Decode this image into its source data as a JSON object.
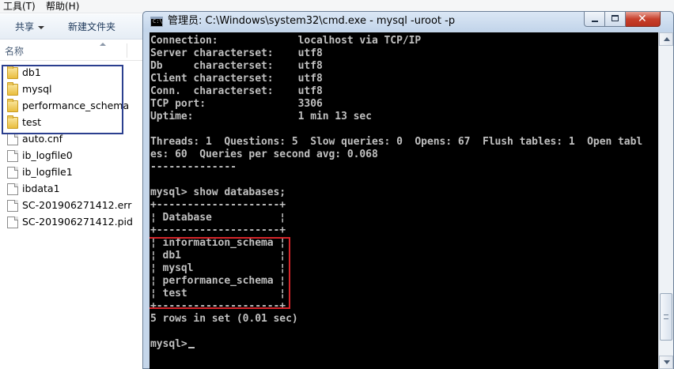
{
  "explorer": {
    "menu": [
      "工具(T)",
      "帮助(H)"
    ],
    "toolbar": {
      "share_label": "共享",
      "new_folder_label": "新建文件夹"
    },
    "column_header": "名称",
    "files": [
      {
        "name": "db1",
        "type": "folder"
      },
      {
        "name": "mysql",
        "type": "folder"
      },
      {
        "name": "performance_schema",
        "type": "folder"
      },
      {
        "name": "test",
        "type": "folder"
      },
      {
        "name": "auto.cnf",
        "type": "file"
      },
      {
        "name": "ib_logfile0",
        "type": "file"
      },
      {
        "name": "ib_logfile1",
        "type": "file"
      },
      {
        "name": "ibdata1",
        "type": "file"
      },
      {
        "name": "SC-201906271412.err",
        "type": "file"
      },
      {
        "name": "SC-201906271412.pid",
        "type": "file"
      }
    ],
    "highlight_color": "#2b3f8f"
  },
  "cmd": {
    "icon_text": "C:\\",
    "title": "管理员: C:\\Windows\\system32\\cmd.exe - mysql  -uroot -p",
    "close_glyph": "✕",
    "lines": [
      "Connection:             localhost via TCP/IP",
      "Server characterset:    utf8",
      "Db     characterset:    utf8",
      "Client characterset:    utf8",
      "Conn.  characterset:    utf8",
      "TCP port:               3306",
      "Uptime:                 1 min 13 sec",
      "",
      "Threads: 1  Questions: 5  Slow queries: 0  Opens: 67  Flush tables: 1  Open tabl",
      "es: 60  Queries per second avg: 0.068",
      "--------------",
      "",
      "mysql> show databases;",
      "+--------------------+",
      "¦ Database           ¦",
      "+--------------------+",
      "¦ information_schema ¦",
      "¦ db1                ¦",
      "¦ mysql              ¦",
      "¦ performance_schema ¦",
      "¦ test               ¦",
      "+--------------------+",
      "5 rows in set (0.01 sec)",
      "",
      "mysql>"
    ],
    "text_color": "#c0c0c0",
    "background_color": "#000000",
    "highlight_color": "#d6252a"
  }
}
